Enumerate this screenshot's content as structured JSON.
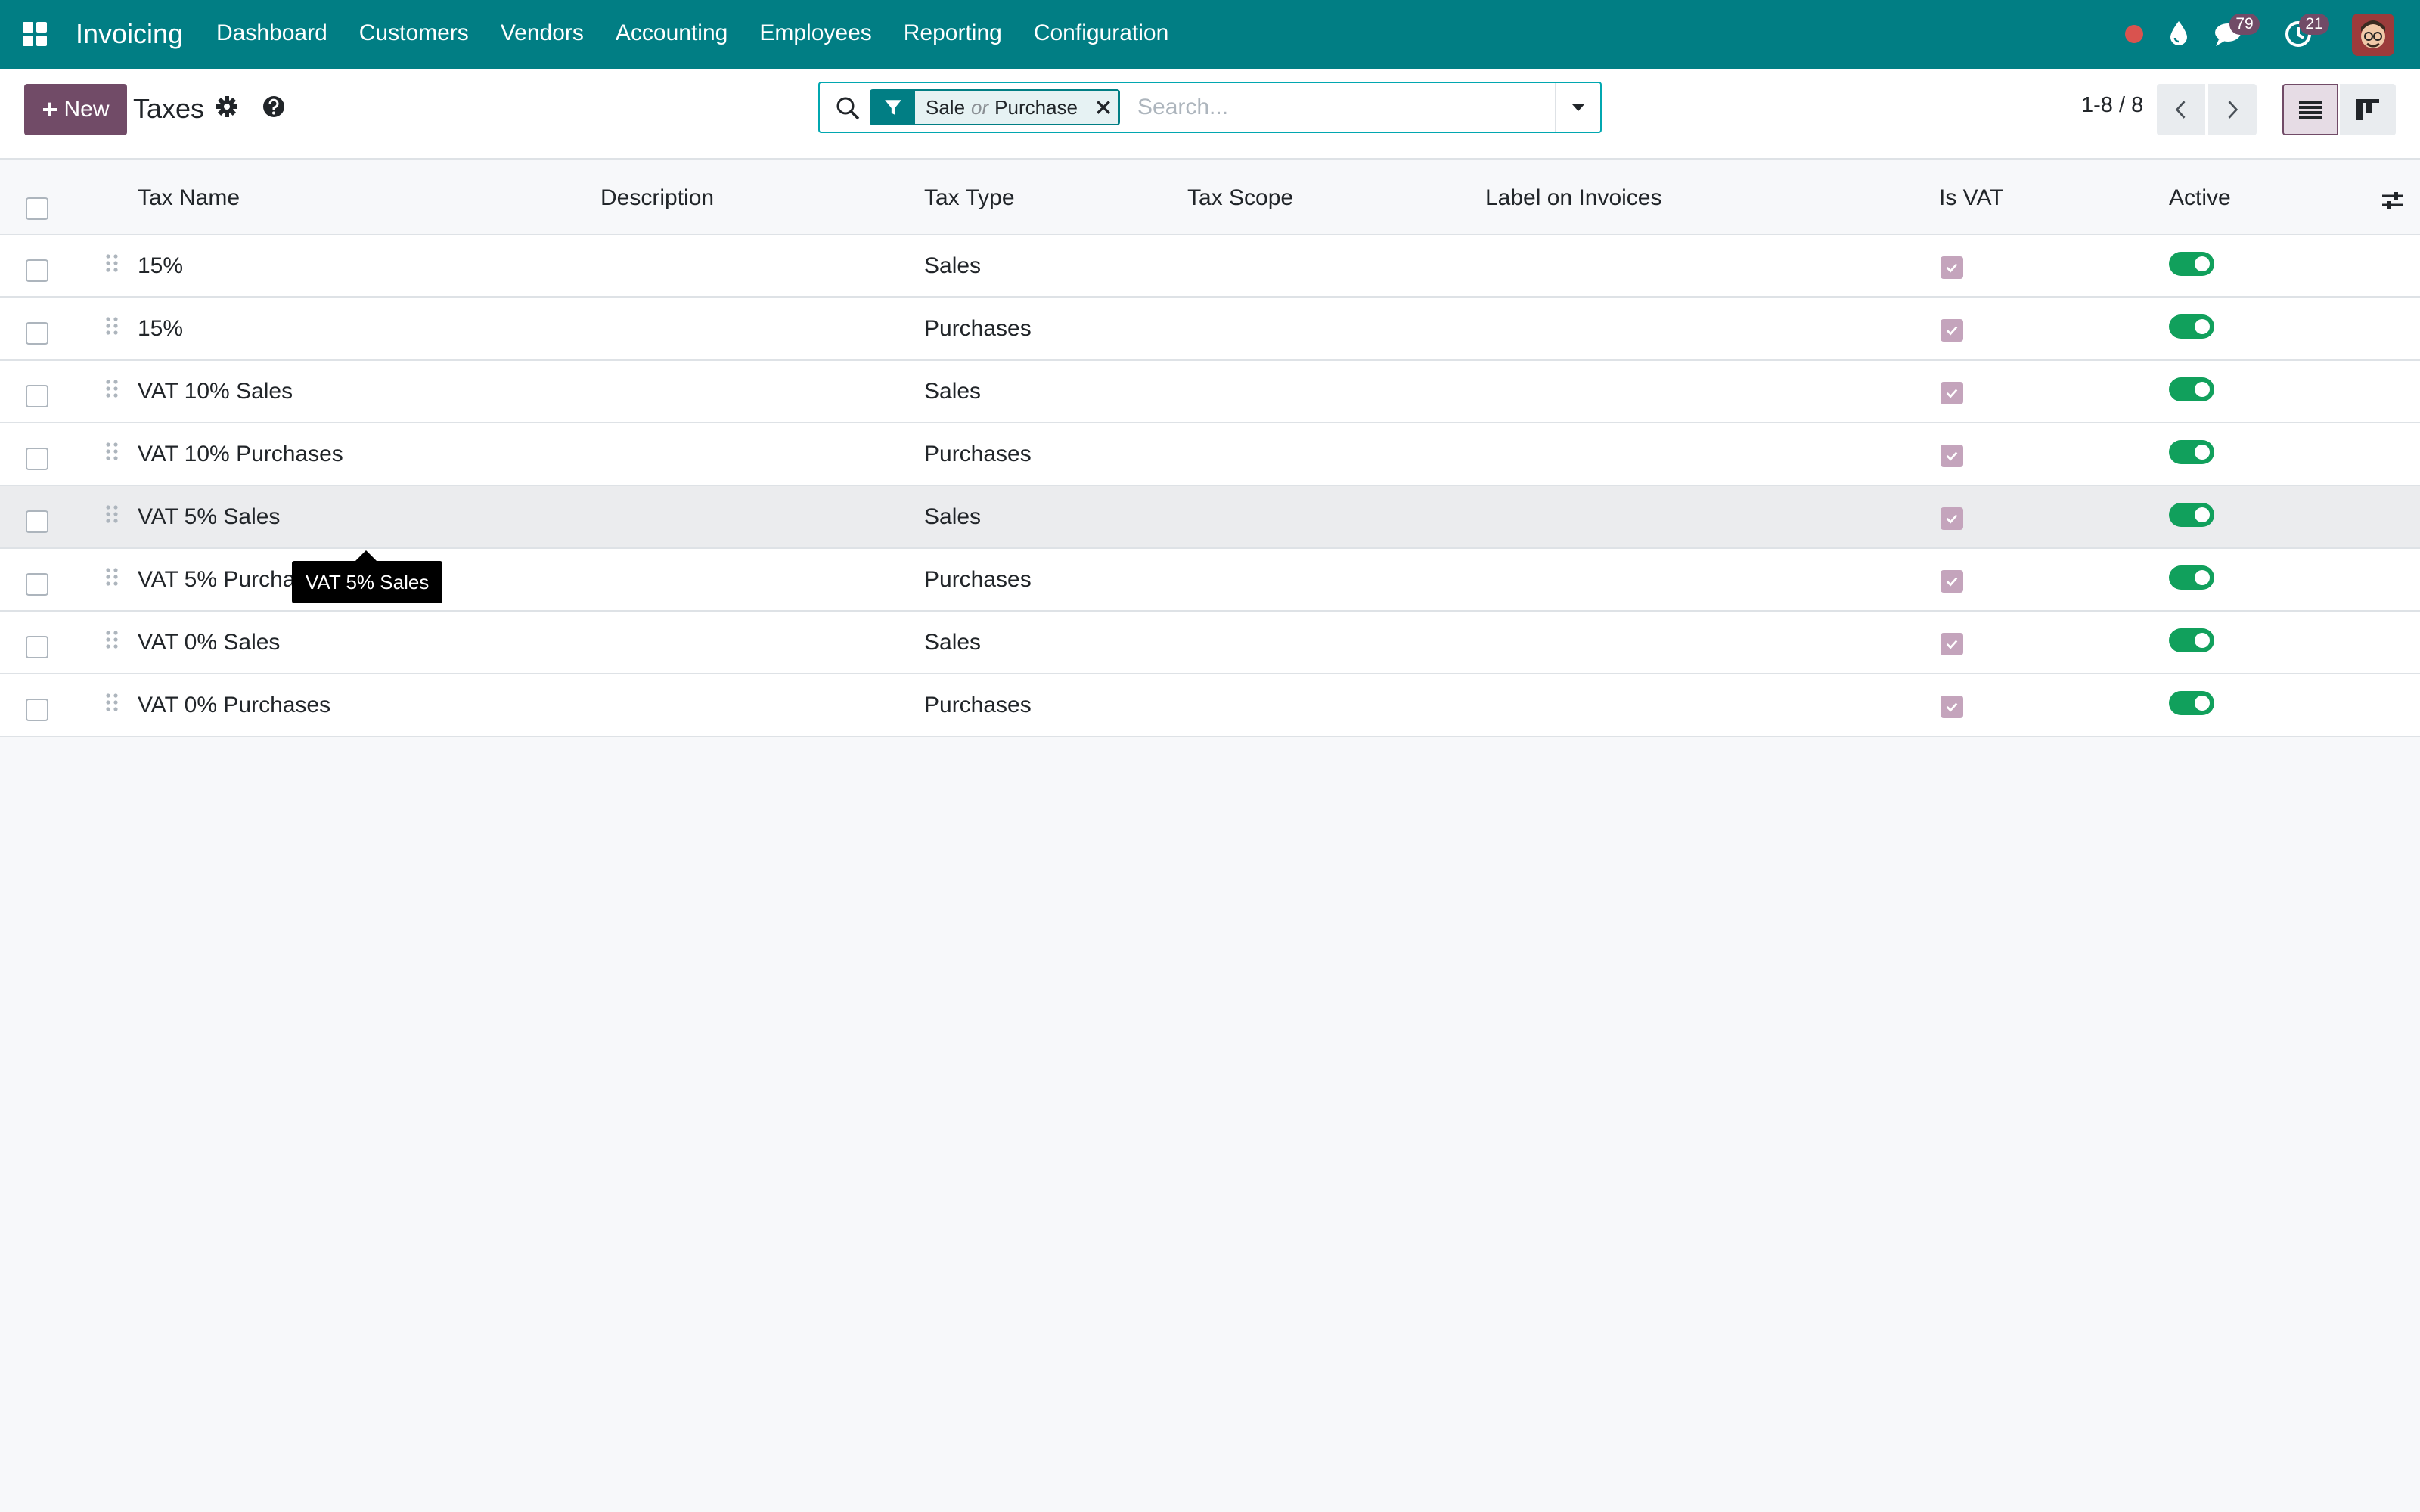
{
  "navbar": {
    "app_name": "Invoicing",
    "menu": [
      "Dashboard",
      "Customers",
      "Vendors",
      "Accounting",
      "Employees",
      "Reporting",
      "Configuration"
    ],
    "messages_count": "79",
    "activities_count": "21"
  },
  "control": {
    "new_label": "New",
    "title": "Taxes",
    "search": {
      "facet_part1": "Sale",
      "facet_or": "or",
      "facet_part2": "Purchase",
      "placeholder": "Search..."
    },
    "pager": "1-8 / 8"
  },
  "table": {
    "columns": [
      "Tax Name",
      "Description",
      "Tax Type",
      "Tax Scope",
      "Label on Invoices",
      "Is VAT",
      "Active"
    ],
    "rows": [
      {
        "name": "15%",
        "description": "",
        "type": "Sales",
        "scope": "",
        "label": "",
        "is_vat": true,
        "active": true
      },
      {
        "name": "15%",
        "description": "",
        "type": "Purchases",
        "scope": "",
        "label": "",
        "is_vat": true,
        "active": true
      },
      {
        "name": "VAT 10% Sales",
        "description": "",
        "type": "Sales",
        "scope": "",
        "label": "",
        "is_vat": true,
        "active": true
      },
      {
        "name": "VAT 10% Purchases",
        "description": "",
        "type": "Purchases",
        "scope": "",
        "label": "",
        "is_vat": true,
        "active": true
      },
      {
        "name": "VAT 5% Sales",
        "description": "",
        "type": "Sales",
        "scope": "",
        "label": "",
        "is_vat": true,
        "active": true
      },
      {
        "name": "VAT 5% Purchases",
        "description": "",
        "type": "Purchases",
        "scope": "",
        "label": "",
        "is_vat": true,
        "active": true
      },
      {
        "name": "VAT 0% Sales",
        "description": "",
        "type": "Sales",
        "scope": "",
        "label": "",
        "is_vat": true,
        "active": true
      },
      {
        "name": "VAT 0% Purchases",
        "description": "",
        "type": "Purchases",
        "scope": "",
        "label": "",
        "is_vat": true,
        "active": true
      }
    ]
  },
  "tooltip": "VAT 5% Sales",
  "colors": {
    "navbar": "#017e84",
    "primary": "#714b67",
    "toggle_on": "#11a05c",
    "record_dot": "#d9534f"
  }
}
